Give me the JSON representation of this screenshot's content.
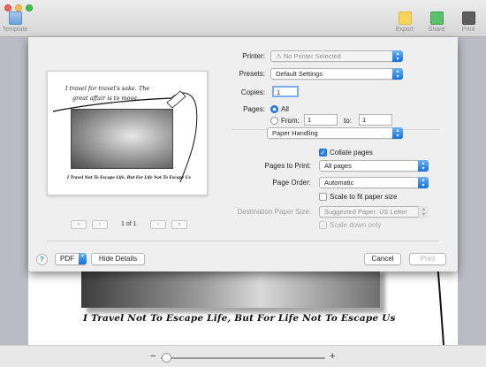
{
  "window": {
    "toolbar": {
      "template_label": "Template",
      "template_icon": "template-icon",
      "export_label": "Export",
      "export_icon": "export-icon",
      "share_label": "Share",
      "share_icon": "share-icon",
      "print_label": "Print",
      "print_icon": "printer-icon"
    }
  },
  "document": {
    "caption": "I Travel Not To Escape Life, But For Life Not To Escape Us"
  },
  "zoom": {
    "minus": "−",
    "plus": "+"
  },
  "preview": {
    "line1": "I travel for travel's sake. The",
    "line2": "great affair is to move.",
    "caption": "I Travel Not To Escape Life, But For Life Not To Escape Us",
    "page_label": "1 of 1",
    "first": "«",
    "prev": "‹",
    "next": "›",
    "last": "»"
  },
  "print": {
    "printer_label": "Printer:",
    "printer_value": "No Printer Selected",
    "presets_label": "Presets:",
    "presets_value": "Default Settings",
    "copies_label": "Copies:",
    "copies_value": "1",
    "pages_label": "Pages:",
    "all_label": "All",
    "from_label": "From:",
    "from_value": "1",
    "to_label": "to:",
    "to_value": "1",
    "section_value": "Paper Handling",
    "collate_label": "Collate pages",
    "pages_to_print_label": "Pages to Print:",
    "pages_to_print_value": "All pages",
    "page_order_label": "Page Order:",
    "page_order_value": "Automatic",
    "scale_fit_label": "Scale to fit paper size",
    "dest_size_label": "Destination Paper Size:",
    "dest_size_value": "Suggested Paper: US Letter",
    "scale_down_label": "Scale down only"
  },
  "footer": {
    "help": "?",
    "pdf": "PDF",
    "hide_details": "Hide Details",
    "cancel": "Cancel",
    "print": "Print"
  },
  "colors": {
    "accent": "#2a7ff2",
    "sheet": "#efefef"
  }
}
